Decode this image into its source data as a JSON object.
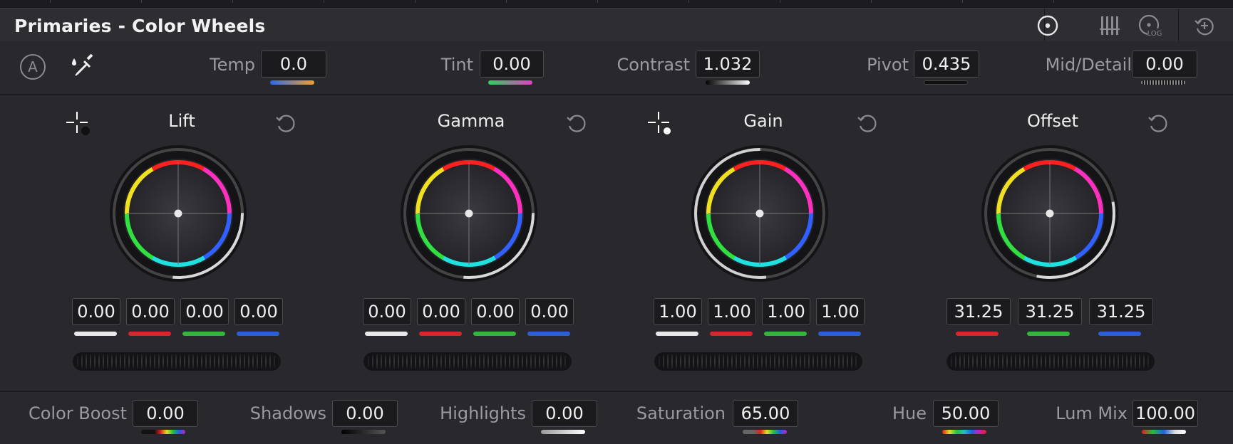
{
  "panel": {
    "title": "Primaries - Color Wheels"
  },
  "header_icons": [
    {
      "name": "color-wheels-mode-icon"
    },
    {
      "name": "bars-mode-icon"
    },
    {
      "name": "log-mode-icon",
      "label": "LOG"
    },
    {
      "name": "reset-all-icon"
    }
  ],
  "top_params": {
    "auto_balance_label": "A",
    "temp": {
      "label": "Temp",
      "value": "0.0"
    },
    "tint": {
      "label": "Tint",
      "value": "0.00"
    },
    "contrast": {
      "label": "Contrast",
      "value": "1.032"
    },
    "pivot": {
      "label": "Pivot",
      "value": "0.435"
    },
    "mid_detail": {
      "label": "Mid/Detail",
      "value": "0.00"
    }
  },
  "wheels": [
    {
      "title": "Lift",
      "values": [
        "0.00",
        "0.00",
        "0.00",
        "0.00"
      ],
      "ring_level": 0.0
    },
    {
      "title": "Gamma",
      "values": [
        "0.00",
        "0.00",
        "0.00",
        "0.00"
      ],
      "ring_level": 0.0
    },
    {
      "title": "Gain",
      "values": [
        "1.00",
        "1.00",
        "1.00",
        "1.00"
      ],
      "ring_level": 1.0
    },
    {
      "title": "Offset",
      "values": [
        "31.25",
        "31.25",
        "31.25"
      ],
      "ring_level": 0.3125
    }
  ],
  "bottom_params": {
    "color_boost": {
      "label": "Color Boost",
      "value": "0.00"
    },
    "shadows": {
      "label": "Shadows",
      "value": "0.00"
    },
    "highlights": {
      "label": "Highlights",
      "value": "0.00"
    },
    "saturation": {
      "label": "Saturation",
      "value": "65.00"
    },
    "hue": {
      "label": "Hue",
      "value": "50.00"
    },
    "lum_mix": {
      "label": "Lum Mix",
      "value": "100.00"
    }
  },
  "colors": {
    "white": "#e8e8e8",
    "red": "#d8262a",
    "green": "#2fb838",
    "blue": "#2b5fd9"
  }
}
